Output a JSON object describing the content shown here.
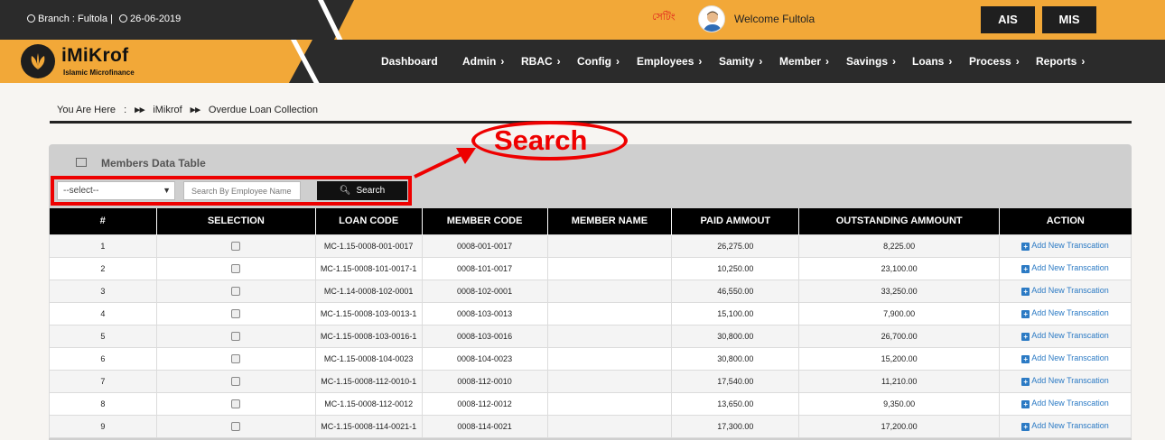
{
  "header": {
    "branch_text": "Branch : Fultola |",
    "date_text": "26-06-2019",
    "language_link": "সেটিং",
    "welcome_text": "Welcome Fultola",
    "ais_label": "AIS",
    "mis_label": "MIS"
  },
  "logo": {
    "title": "iMiKrof",
    "subtitle": "Islamic Microfinance"
  },
  "nav": {
    "items": [
      {
        "label": "Dashboard"
      },
      {
        "label": "Admin"
      },
      {
        "label": "RBAC"
      },
      {
        "label": "Config"
      },
      {
        "label": "Employees"
      },
      {
        "label": "Samity"
      },
      {
        "label": "Member"
      },
      {
        "label": "Savings"
      },
      {
        "label": "Loans"
      },
      {
        "label": "Process"
      },
      {
        "label": "Reports"
      }
    ]
  },
  "breadcrumb": {
    "prefix": "You Are Here",
    "sep": ":",
    "home": "iMikrof",
    "current": "Overdue Loan Collection"
  },
  "annotation": {
    "label": "Search"
  },
  "panel": {
    "title": "Members Data Table",
    "select_value": "--select--",
    "search_placeholder": "Search By Employee Name",
    "search_button": "Search"
  },
  "table": {
    "headers": [
      "#",
      "SELECTION",
      "LOAN CODE",
      "MEMBER CODE",
      "MEMBER NAME",
      "PAID AMMOUT",
      "OUTSTANDING AMMOUNT",
      "ACTION"
    ],
    "action_label": "Add New Transcation",
    "rows": [
      {
        "num": "1",
        "loan_code": "MC-1.15-0008-001-0017",
        "member_code": "0008-001-0017",
        "member_name": "",
        "paid": "26,275.00",
        "outstanding": "8,225.00"
      },
      {
        "num": "2",
        "loan_code": "MC-1.15-0008-101-0017-1",
        "member_code": "0008-101-0017",
        "member_name": "",
        "paid": "10,250.00",
        "outstanding": "23,100.00"
      },
      {
        "num": "3",
        "loan_code": "MC-1.14-0008-102-0001",
        "member_code": "0008-102-0001",
        "member_name": "",
        "paid": "46,550.00",
        "outstanding": "33,250.00"
      },
      {
        "num": "4",
        "loan_code": "MC-1.15-0008-103-0013-1",
        "member_code": "0008-103-0013",
        "member_name": "",
        "paid": "15,100.00",
        "outstanding": "7,900.00"
      },
      {
        "num": "5",
        "loan_code": "MC-1.15-0008-103-0016-1",
        "member_code": "0008-103-0016",
        "member_name": "",
        "paid": "30,800.00",
        "outstanding": "26,700.00"
      },
      {
        "num": "6",
        "loan_code": "MC-1.15-0008-104-0023",
        "member_code": "0008-104-0023",
        "member_name": "",
        "paid": "30,800.00",
        "outstanding": "15,200.00"
      },
      {
        "num": "7",
        "loan_code": "MC-1.15-0008-112-0010-1",
        "member_code": "0008-112-0010",
        "member_name": "",
        "paid": "17,540.00",
        "outstanding": "11,210.00"
      },
      {
        "num": "8",
        "loan_code": "MC-1.15-0008-112-0012",
        "member_code": "0008-112-0012",
        "member_name": "",
        "paid": "13,650.00",
        "outstanding": "9,350.00"
      },
      {
        "num": "9",
        "loan_code": "MC-1.15-0008-114-0021-1",
        "member_code": "0008-114-0021",
        "member_name": "",
        "paid": "17,300.00",
        "outstanding": "17,200.00"
      }
    ]
  }
}
